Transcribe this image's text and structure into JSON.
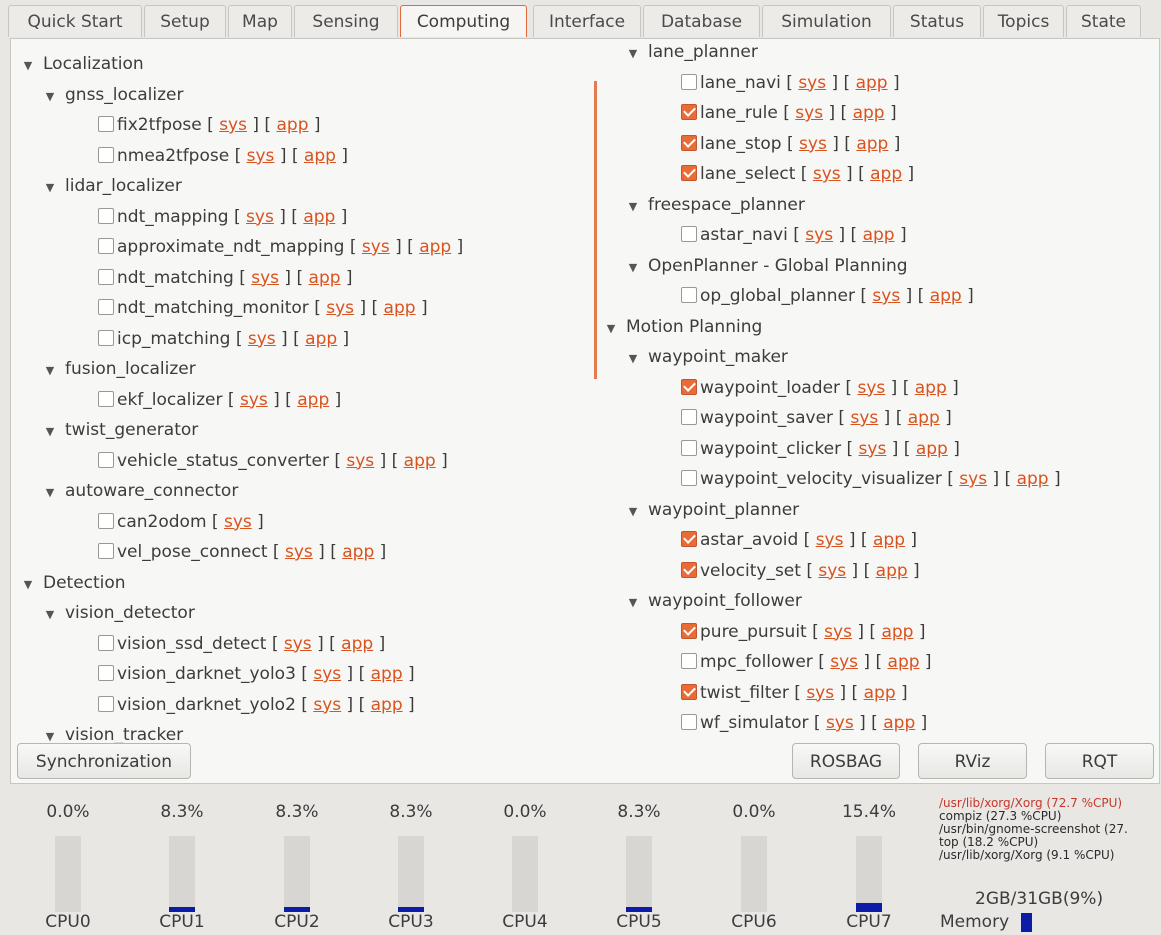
{
  "tabs": [
    {
      "label": "Quick Start",
      "active": false
    },
    {
      "label": "Setup",
      "active": false
    },
    {
      "label": "Map",
      "active": false
    },
    {
      "label": "Sensing",
      "active": false
    },
    {
      "label": "Computing",
      "active": true
    },
    {
      "label": "Interface",
      "active": false
    },
    {
      "label": "Database",
      "active": false
    },
    {
      "label": "Simulation",
      "active": false
    },
    {
      "label": "Status",
      "active": false
    },
    {
      "label": "Topics",
      "active": false
    },
    {
      "label": "State",
      "active": false
    }
  ],
  "links": {
    "sys": "sys",
    "app": "app"
  },
  "left_tree": [
    {
      "level": 0,
      "kind": "group",
      "label": "Localization"
    },
    {
      "level": 1,
      "kind": "group",
      "label": "gnss_localizer"
    },
    {
      "level": 2,
      "kind": "node",
      "label": "fix2tfpose",
      "checked": false,
      "sys": true,
      "app": true
    },
    {
      "level": 2,
      "kind": "node",
      "label": "nmea2tfpose",
      "checked": false,
      "sys": true,
      "app": true
    },
    {
      "level": 1,
      "kind": "group",
      "label": "lidar_localizer"
    },
    {
      "level": 2,
      "kind": "node",
      "label": "ndt_mapping",
      "checked": false,
      "sys": true,
      "app": true
    },
    {
      "level": 2,
      "kind": "node",
      "label": "approximate_ndt_mapping",
      "checked": false,
      "sys": true,
      "app": true
    },
    {
      "level": 2,
      "kind": "node",
      "label": "ndt_matching",
      "checked": false,
      "sys": true,
      "app": true
    },
    {
      "level": 2,
      "kind": "node",
      "label": "ndt_matching_monitor",
      "checked": false,
      "sys": true,
      "app": true
    },
    {
      "level": 2,
      "kind": "node",
      "label": "icp_matching",
      "checked": false,
      "sys": true,
      "app": true
    },
    {
      "level": 1,
      "kind": "group",
      "label": "fusion_localizer"
    },
    {
      "level": 2,
      "kind": "node",
      "label": "ekf_localizer",
      "checked": false,
      "sys": true,
      "app": true
    },
    {
      "level": 1,
      "kind": "group",
      "label": "twist_generator"
    },
    {
      "level": 2,
      "kind": "node",
      "label": "vehicle_status_converter",
      "checked": false,
      "sys": true,
      "app": true
    },
    {
      "level": 1,
      "kind": "group",
      "label": "autoware_connector"
    },
    {
      "level": 2,
      "kind": "node",
      "label": "can2odom",
      "checked": false,
      "sys": true,
      "app": false
    },
    {
      "level": 2,
      "kind": "node",
      "label": "vel_pose_connect",
      "checked": false,
      "sys": true,
      "app": true
    },
    {
      "level": 0,
      "kind": "group",
      "label": "Detection"
    },
    {
      "level": 1,
      "kind": "group",
      "label": "vision_detector"
    },
    {
      "level": 2,
      "kind": "node",
      "label": "vision_ssd_detect",
      "checked": false,
      "sys": true,
      "app": true
    },
    {
      "level": 2,
      "kind": "node",
      "label": "vision_darknet_yolo3",
      "checked": false,
      "sys": true,
      "app": true
    },
    {
      "level": 2,
      "kind": "node",
      "label": "vision_darknet_yolo2",
      "checked": false,
      "sys": true,
      "app": true
    },
    {
      "level": 1,
      "kind": "group",
      "label": "vision_tracker"
    }
  ],
  "right_tree": [
    {
      "level": 1,
      "kind": "group",
      "label": "lane_planner"
    },
    {
      "level": 2,
      "kind": "node",
      "label": "lane_navi",
      "checked": false,
      "sys": true,
      "app": true
    },
    {
      "level": 2,
      "kind": "node",
      "label": "lane_rule",
      "checked": true,
      "sys": true,
      "app": true
    },
    {
      "level": 2,
      "kind": "node",
      "label": "lane_stop",
      "checked": true,
      "sys": true,
      "app": true
    },
    {
      "level": 2,
      "kind": "node",
      "label": "lane_select",
      "checked": true,
      "sys": true,
      "app": true
    },
    {
      "level": 1,
      "kind": "group",
      "label": "freespace_planner"
    },
    {
      "level": 2,
      "kind": "node",
      "label": "astar_navi",
      "checked": false,
      "sys": true,
      "app": true
    },
    {
      "level": 1,
      "kind": "group",
      "label": "OpenPlanner - Global Planning"
    },
    {
      "level": 2,
      "kind": "node",
      "label": "op_global_planner",
      "checked": false,
      "sys": true,
      "app": true
    },
    {
      "level": 0,
      "kind": "group",
      "label": "Motion Planning"
    },
    {
      "level": 1,
      "kind": "group",
      "label": "waypoint_maker"
    },
    {
      "level": 2,
      "kind": "node",
      "label": "waypoint_loader",
      "checked": true,
      "sys": true,
      "app": true
    },
    {
      "level": 2,
      "kind": "node",
      "label": "waypoint_saver",
      "checked": false,
      "sys": true,
      "app": true
    },
    {
      "level": 2,
      "kind": "node",
      "label": "waypoint_clicker",
      "checked": false,
      "sys": true,
      "app": true
    },
    {
      "level": 2,
      "kind": "node",
      "label": "waypoint_velocity_visualizer",
      "checked": false,
      "sys": true,
      "app": true
    },
    {
      "level": 1,
      "kind": "group",
      "label": "waypoint_planner"
    },
    {
      "level": 2,
      "kind": "node",
      "label": "astar_avoid",
      "checked": true,
      "sys": true,
      "app": true
    },
    {
      "level": 2,
      "kind": "node",
      "label": "velocity_set",
      "checked": true,
      "sys": true,
      "app": true
    },
    {
      "level": 1,
      "kind": "group",
      "label": "waypoint_follower"
    },
    {
      "level": 2,
      "kind": "node",
      "label": "pure_pursuit",
      "checked": true,
      "sys": true,
      "app": true
    },
    {
      "level": 2,
      "kind": "node",
      "label": "mpc_follower",
      "checked": false,
      "sys": true,
      "app": true
    },
    {
      "level": 2,
      "kind": "node",
      "label": "twist_filter",
      "checked": true,
      "sys": true,
      "app": true
    },
    {
      "level": 2,
      "kind": "node",
      "label": "wf_simulator",
      "checked": false,
      "sys": true,
      "app": true
    }
  ],
  "buttons": {
    "synchronization": "Synchronization",
    "rosbag": "ROSBAG",
    "rviz": "RViz",
    "rqt": "RQT"
  },
  "cpus": [
    {
      "name": "CPU0",
      "percent": "0.0%",
      "load": 0.0
    },
    {
      "name": "CPU1",
      "percent": "8.3%",
      "load": 8.3
    },
    {
      "name": "CPU2",
      "percent": "8.3%",
      "load": 8.3
    },
    {
      "name": "CPU3",
      "percent": "8.3%",
      "load": 8.3
    },
    {
      "name": "CPU4",
      "percent": "0.0%",
      "load": 0.0
    },
    {
      "name": "CPU5",
      "percent": "8.3%",
      "load": 8.3
    },
    {
      "name": "CPU6",
      "percent": "0.0%",
      "load": 0.0
    },
    {
      "name": "CPU7",
      "percent": "15.4%",
      "load": 15.4
    }
  ],
  "processes": [
    "/usr/lib/xorg/Xorg (72.7 %CPU)",
    "compiz (27.3 %CPU)",
    "/usr/bin/gnome-screenshot (27.",
    "top (18.2 %CPU)",
    "/usr/lib/xorg/Xorg (9.1 %CPU)"
  ],
  "memory": {
    "label": "Memory",
    "text": "2GB/31GB(9%)",
    "fraction": 0.09
  },
  "colors": {
    "accent": "#e96c38",
    "link": "#d9531e",
    "bar": "#0b1da8"
  }
}
